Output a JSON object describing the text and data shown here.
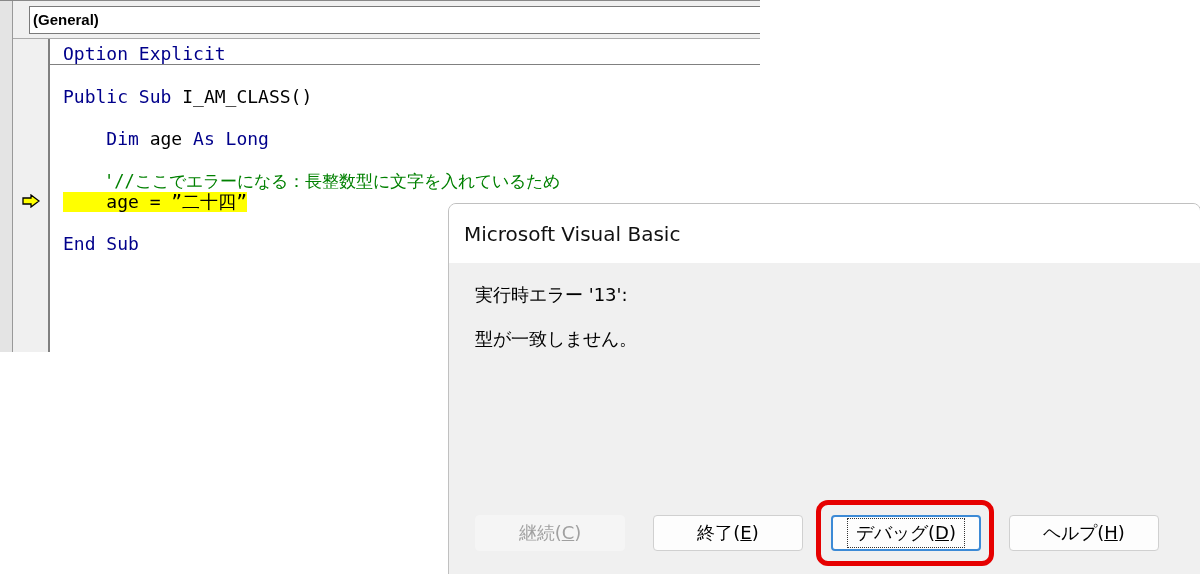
{
  "editor": {
    "object_dropdown": "(General)",
    "code_blocks": [
      [
        {
          "current": false,
          "tokens": [
            {
              "kind": "keyword",
              "text": "Option Explicit"
            }
          ]
        }
      ],
      [
        {
          "current": false,
          "tokens": [
            {
              "kind": "keyword",
              "text": "Public Sub"
            },
            {
              "kind": "plain",
              "text": " I_AM_CLASS()"
            }
          ]
        }
      ],
      [
        {
          "current": false,
          "tokens": [
            {
              "kind": "keyword",
              "text": "    Dim"
            },
            {
              "kind": "plain",
              "text": " age "
            },
            {
              "kind": "keyword",
              "text": "As Long"
            }
          ]
        }
      ],
      [
        {
          "current": false,
          "tokens": [
            {
              "kind": "comment",
              "text": "    '//ここでエラーになる：長整数型に文字を入れているため"
            }
          ]
        },
        {
          "current": true,
          "tokens": [
            {
              "kind": "plain",
              "text": "    age = ”二十四”"
            }
          ]
        }
      ],
      [
        {
          "current": false,
          "tokens": [
            {
              "kind": "keyword",
              "text": "End Sub"
            }
          ]
        }
      ]
    ]
  },
  "dialog": {
    "title": "Microsoft Visual Basic",
    "messages": [
      "実行時エラー '13':",
      "型が一致しません。"
    ],
    "buttons": [
      {
        "before": "継続(",
        "mnemonic": "C",
        "after": ")",
        "disabled": true,
        "focused": false,
        "highlighted": false
      },
      {
        "before": "終了(",
        "mnemonic": "E",
        "after": ")",
        "disabled": false,
        "focused": false,
        "highlighted": false
      },
      {
        "before": "デバッグ(",
        "mnemonic": "D",
        "after": ")",
        "disabled": false,
        "focused": true,
        "highlighted": true
      },
      {
        "before": "ヘルプ(",
        "mnemonic": "H",
        "after": ")",
        "disabled": false,
        "focused": false,
        "highlighted": false
      }
    ]
  }
}
